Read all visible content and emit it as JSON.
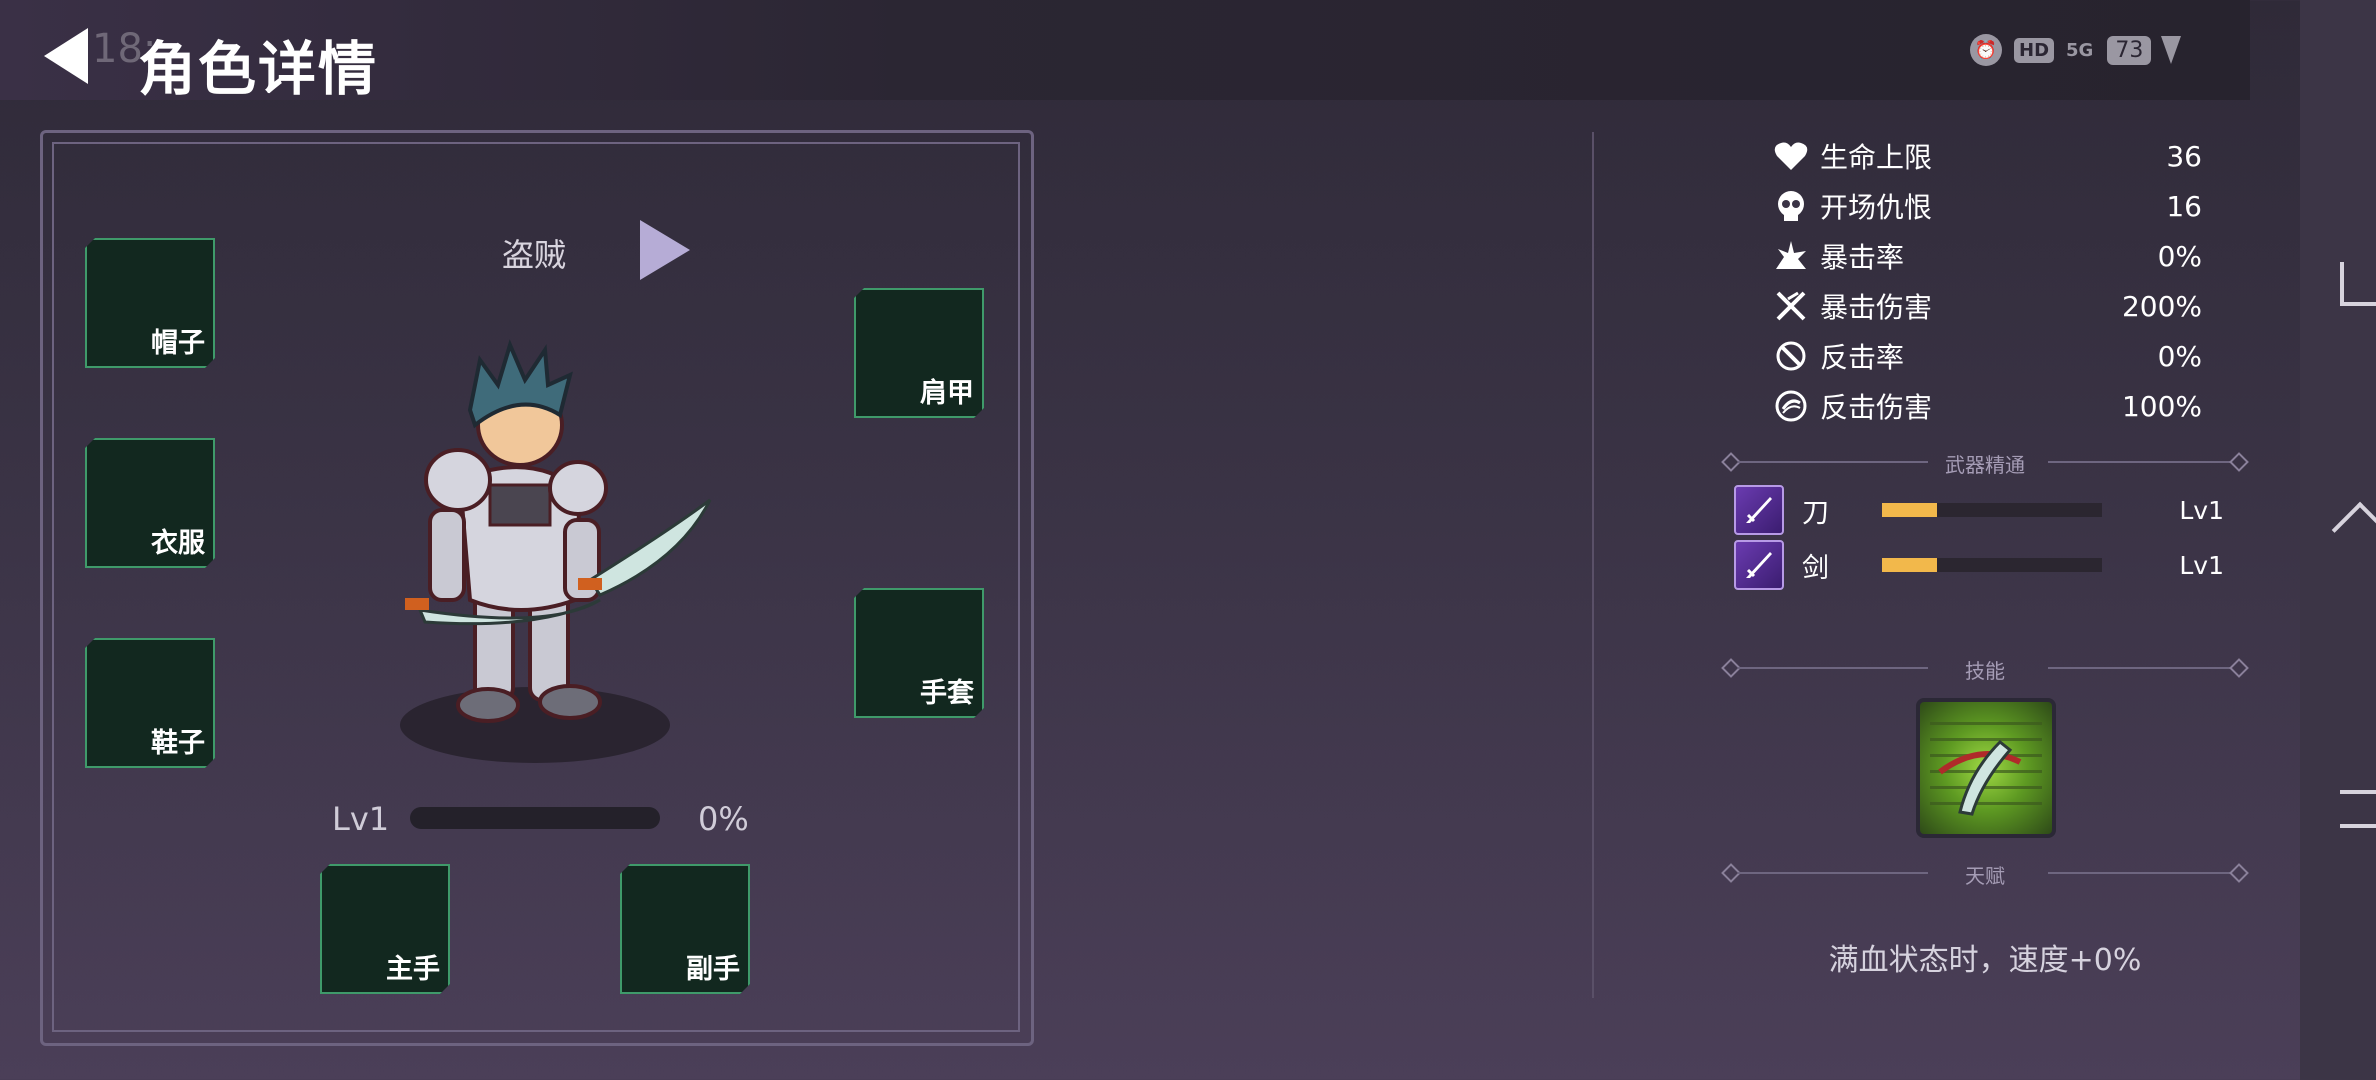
{
  "header": {
    "title": "角色详情",
    "clock": "18:"
  },
  "status_bar": {
    "battery": "73",
    "hd": "HD",
    "network": "5G"
  },
  "character": {
    "class_name": "盗贼",
    "level_label": "Lv1",
    "xp_percent": "0%",
    "xp_fraction": 0.0
  },
  "equipment": {
    "hat": "帽子",
    "clothes": "衣服",
    "shoes": "鞋子",
    "shoulder": "肩甲",
    "gloves": "手套",
    "main_hand": "主手",
    "off_hand": "副手"
  },
  "stats": [
    {
      "name": "生命上限",
      "value": "36",
      "icon": "heart-icon"
    },
    {
      "name": "开场仇恨",
      "value": "16",
      "icon": "skull-icon"
    },
    {
      "name": "暴击率",
      "value": "0%",
      "icon": "crit-burst-icon"
    },
    {
      "name": "暴击伤害",
      "value": "200%",
      "icon": "crossed-swords-icon"
    },
    {
      "name": "反击率",
      "value": "0%",
      "icon": "counter-icon"
    },
    {
      "name": "反击伤害",
      "value": "100%",
      "icon": "counter-damage-icon"
    }
  ],
  "weapon_mastery": {
    "title": "武器精通",
    "items": [
      {
        "name": "刀",
        "level": "Lv1",
        "progress": 0.25,
        "icon": "blade-icon"
      },
      {
        "name": "剑",
        "level": "Lv1",
        "progress": 0.25,
        "icon": "sword-icon"
      }
    ]
  },
  "skills": {
    "title": "技能",
    "icon": "slash-skill-icon"
  },
  "talent": {
    "title": "天赋",
    "text": "满血状态时，速度+0%"
  },
  "colors": {
    "accent": "#f2b84b",
    "slot_bg": "#12281f",
    "slot_border": "#3f9a6a",
    "weapon_icon": "#6a3bb0"
  }
}
